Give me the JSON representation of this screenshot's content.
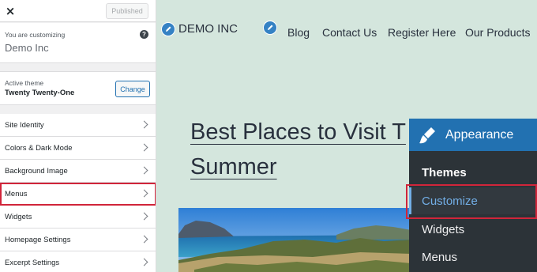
{
  "customizer": {
    "close_label": "×",
    "publish_label": "Published",
    "customizing_label": "You are customizing",
    "site_name": "Demo Inc",
    "help_label": "?",
    "active_theme_label": "Active theme",
    "theme_name": "Twenty Twenty-One",
    "change_label": "Change",
    "sections": [
      {
        "label": "Site Identity"
      },
      {
        "label": "Colors & Dark Mode"
      },
      {
        "label": "Background Image"
      },
      {
        "label": "Menus"
      },
      {
        "label": "Widgets"
      },
      {
        "label": "Homepage Settings"
      },
      {
        "label": "Excerpt Settings"
      }
    ],
    "highlighted_section": "Menus"
  },
  "preview": {
    "site_title": "DEMO INC",
    "nav": [
      "Blog",
      "Contact Us",
      "Register Here",
      "Our Products"
    ],
    "post_title_line1": "Best Places to Visit T",
    "post_title_line2": "Summer"
  },
  "admin_menu": {
    "title": "Appearance",
    "items": [
      {
        "label": "Themes"
      },
      {
        "label": "Customize"
      },
      {
        "label": "Widgets"
      },
      {
        "label": "Menus"
      }
    ],
    "current": "Customize"
  },
  "colors": {
    "accent": "#2271b1",
    "highlight_border": "#d1253a",
    "preview_bg": "#d4e6dd"
  }
}
